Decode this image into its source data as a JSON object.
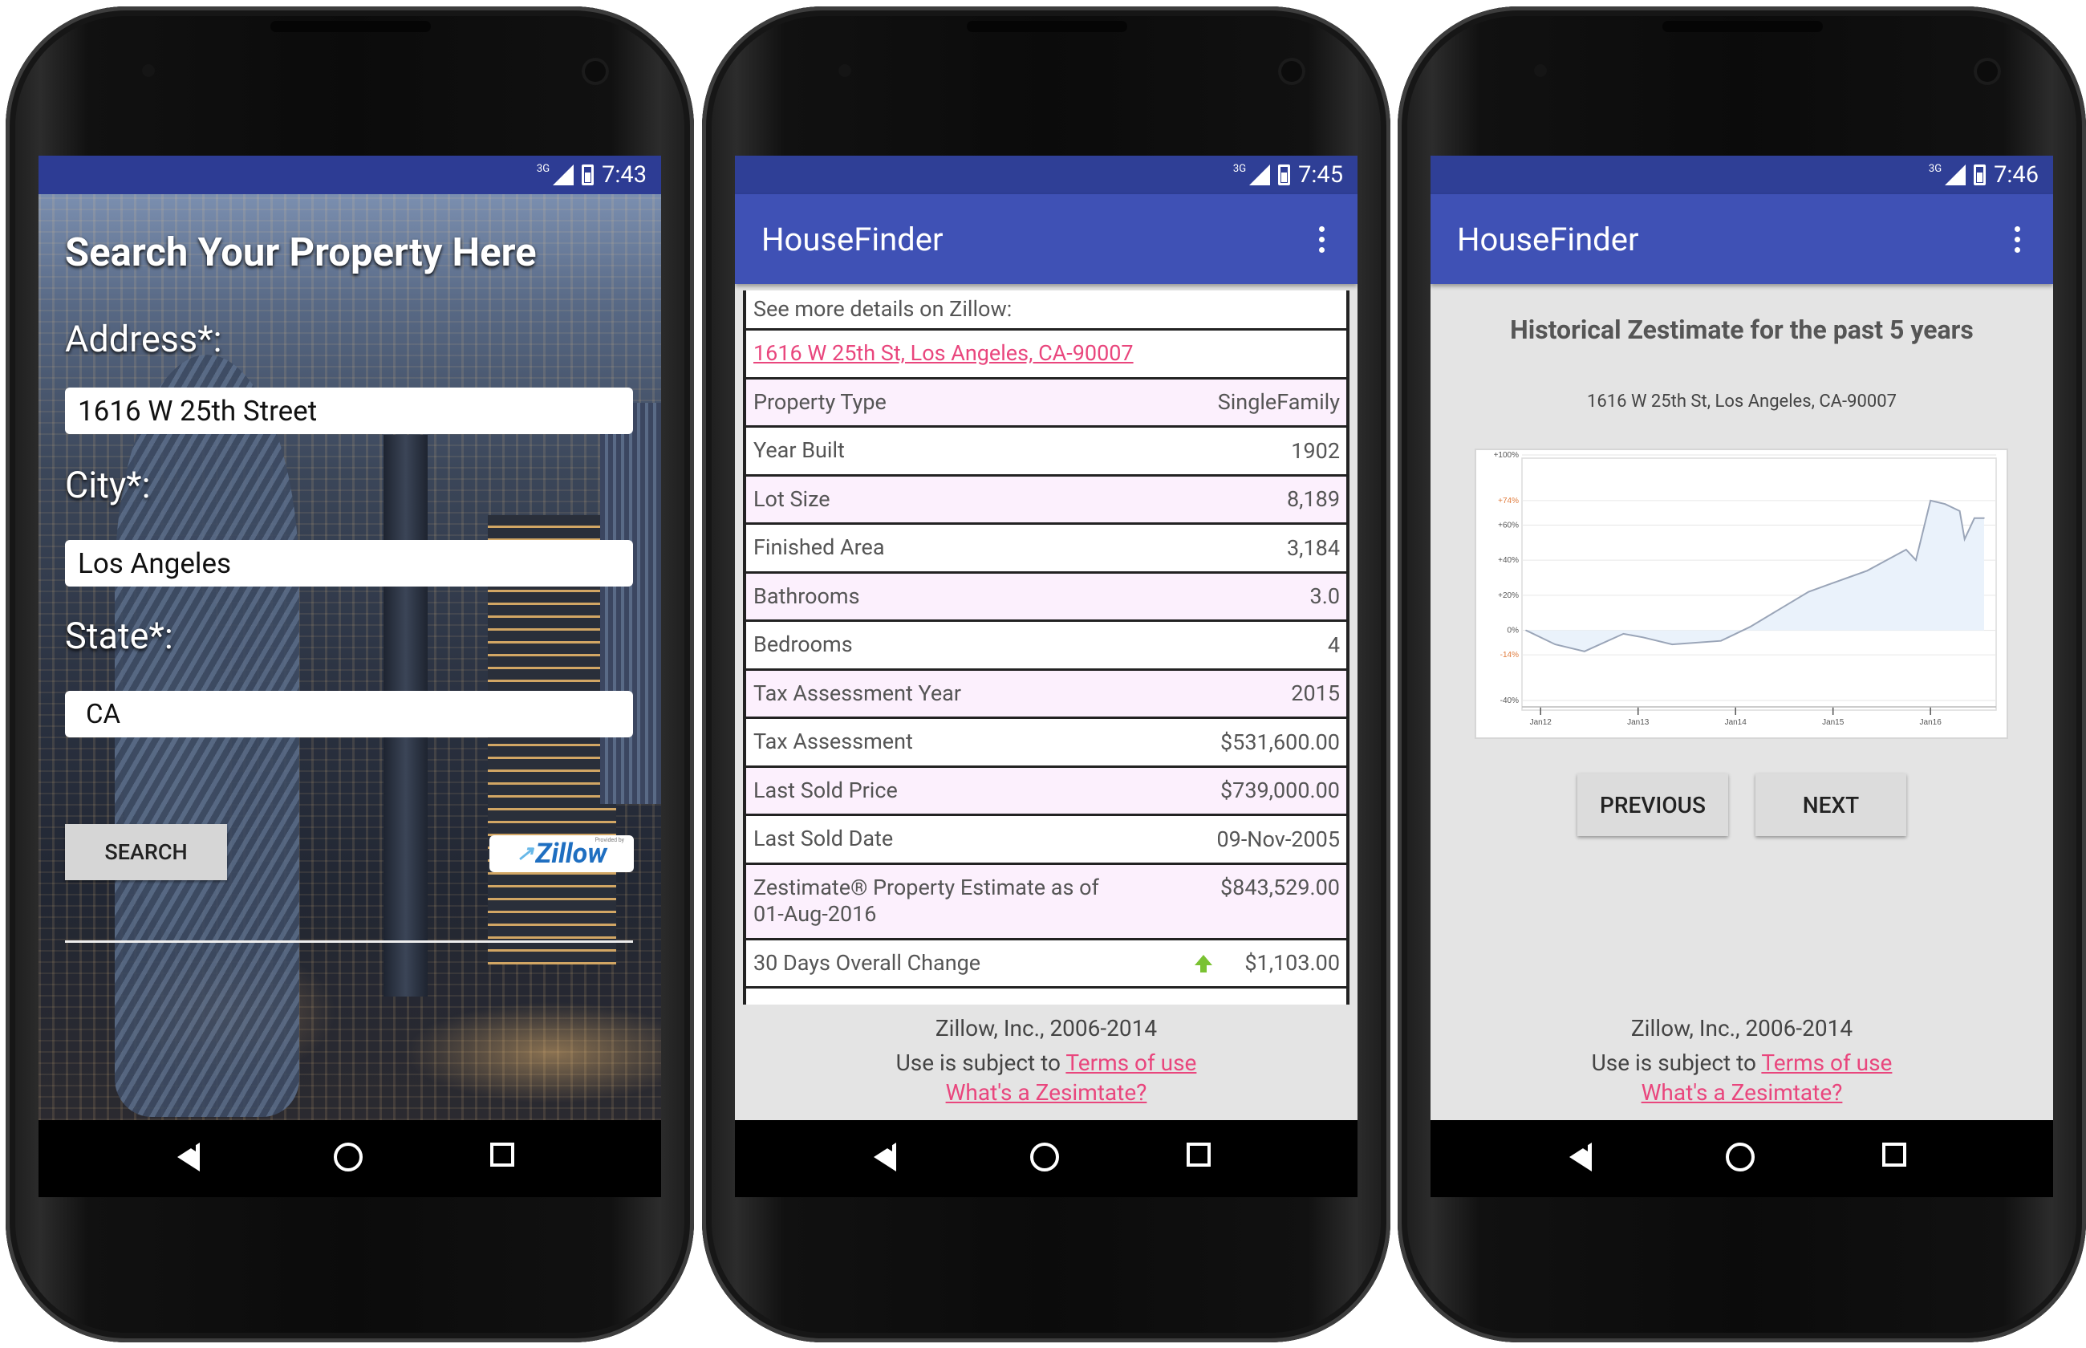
{
  "phones": [
    {
      "status": {
        "time": "7:43",
        "network": "3G"
      },
      "title": "Search Your Property Here",
      "address_label": "Address*:",
      "address_value": "1616 W 25th Street",
      "city_label": "City*:",
      "city_value": "Los Angeles",
      "state_label": "State*:",
      "state_value": "CA",
      "search_button": "SEARCH",
      "zillow_badge": "Zillow",
      "zillow_badge_small": "Provided by"
    },
    {
      "status": {
        "time": "7:45",
        "network": "3G"
      },
      "app_title": "HouseFinder",
      "details_header": "See more details on Zillow:",
      "address_link": "1616 W 25th St, Los Angeles, CA-90007",
      "rows": [
        {
          "label": "Property Type",
          "value": "SingleFamily"
        },
        {
          "label": "Year Built",
          "value": "1902"
        },
        {
          "label": "Lot Size",
          "value": "8,189"
        },
        {
          "label": "Finished Area",
          "value": "3,184"
        },
        {
          "label": "Bathrooms",
          "value": "3.0"
        },
        {
          "label": "Bedrooms",
          "value": "4"
        },
        {
          "label": "Tax Assessment Year",
          "value": "2015"
        },
        {
          "label": "Tax Assessment",
          "value": "$531,600.00"
        },
        {
          "label": "Last Sold Price",
          "value": "$739,000.00"
        },
        {
          "label": "Last Sold Date",
          "value": "09-Nov-2005"
        },
        {
          "label": "Zestimate® Property Estimate as of 01-Aug-2016",
          "value": "$843,529.00"
        },
        {
          "label": "30 Days Overall Change",
          "value": "$1,103.00"
        }
      ],
      "footer": {
        "copyright": "Zillow, Inc., 2006-2014",
        "terms_prefix": "Use is subject to ",
        "terms_link": "Terms of use",
        "zestimate_link": "What's a Zesimtate?"
      }
    },
    {
      "status": {
        "time": "7:46",
        "network": "3G"
      },
      "app_title": "HouseFinder",
      "chart_title": "Historical Zestimate for the past 5 years",
      "chart_address": "1616 W 25th St, Los Angeles, CA-90007",
      "previous_button": "PREVIOUS",
      "next_button": "NEXT",
      "footer": {
        "copyright": "Zillow, Inc., 2006-2014",
        "terms_prefix": "Use is subject to ",
        "terms_link": "Terms of use",
        "zestimate_link": "What's a Zesimtate?"
      }
    }
  ],
  "chart_data": {
    "type": "area",
    "y_ticks": [
      "+100%",
      "+74%",
      "+60%",
      "+40%",
      "+20%",
      "0%",
      "-14%",
      "-40%"
    ],
    "highlight_ticks": [
      "+74%",
      "-14%"
    ],
    "x_ticks": [
      "Jan12",
      "Jan13",
      "Jan14",
      "Jan15",
      "Jan16"
    ],
    "ylim": [
      -40,
      100
    ],
    "x": [
      0,
      0.3,
      0.6,
      1.0,
      1.2,
      1.5,
      2.0,
      2.3,
      2.6,
      2.9,
      3.1,
      3.3,
      3.5,
      3.7,
      3.9,
      4.0,
      4.15,
      4.3,
      4.45,
      4.5,
      4.6,
      4.7
    ],
    "values": [
      0,
      -8,
      -12,
      -2,
      -4,
      -8,
      -6,
      2,
      12,
      22,
      26,
      30,
      34,
      40,
      46,
      40,
      74,
      72,
      68,
      52,
      64,
      64
    ],
    "colors": {
      "line": "#9aa5b8",
      "fill": "#eaf2fb",
      "highlight": "#e07b3c"
    }
  },
  "colors": {
    "statusbar": "#2f3f96",
    "appbar": "#3f51b5",
    "row_alt": "#fcf0fd",
    "link": "#e9467d"
  }
}
